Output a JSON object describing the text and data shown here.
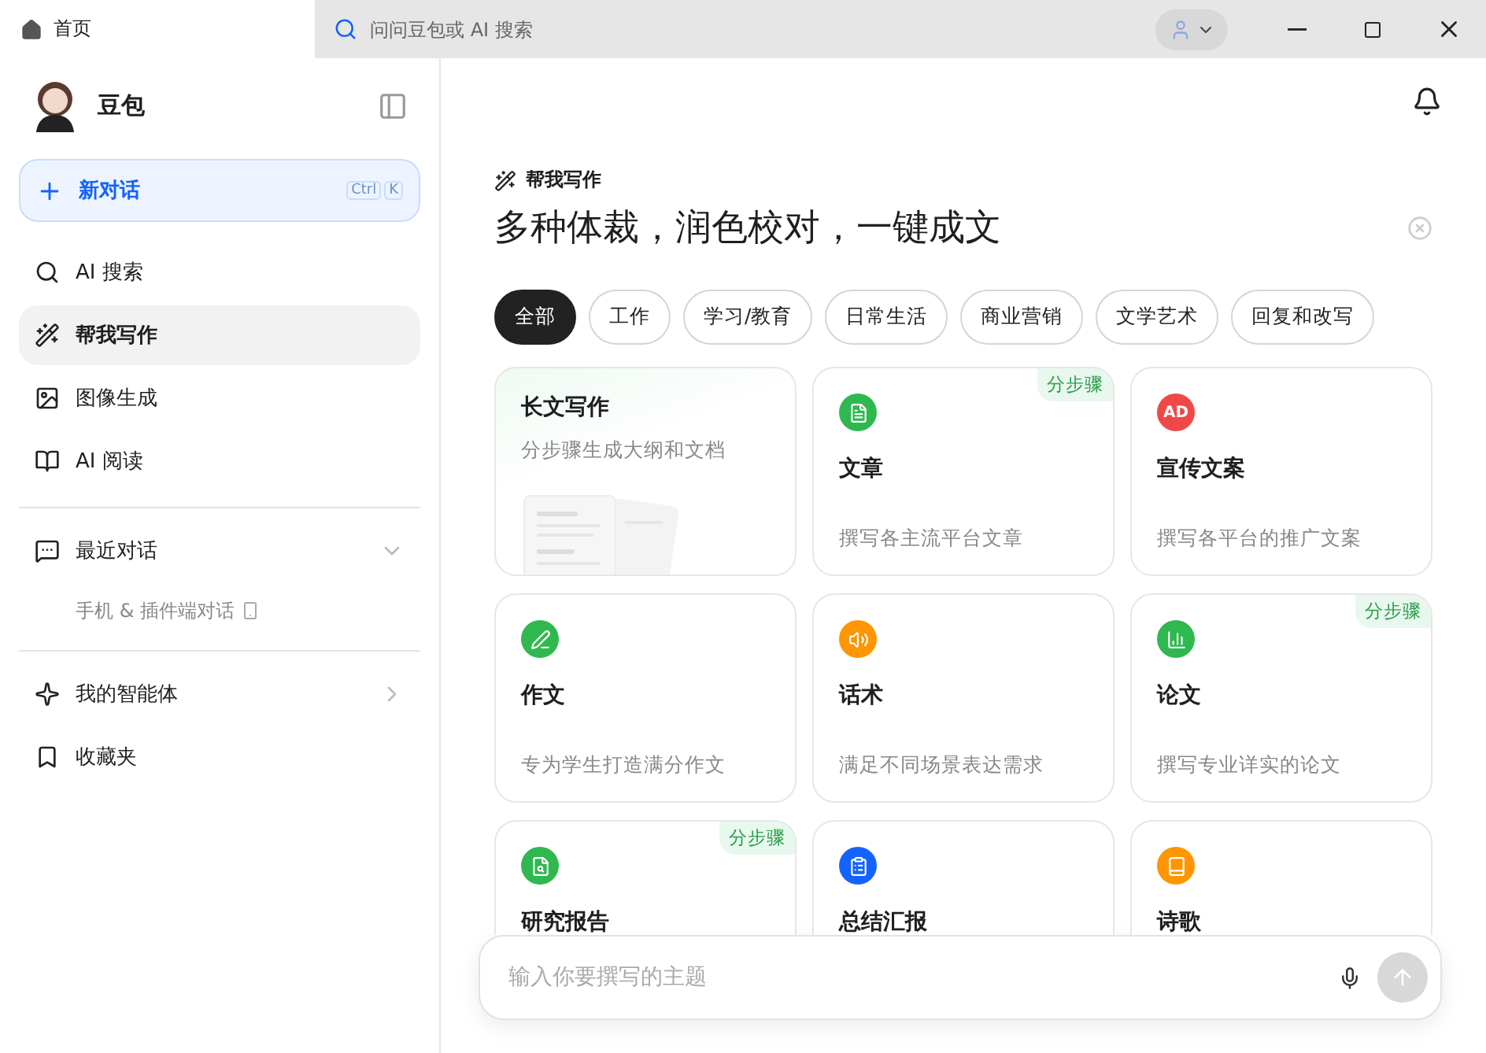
{
  "tabs": [
    {
      "label": "首页",
      "selected": true
    }
  ],
  "address_bar": {
    "placeholder": "问问豆包或 AI 搜索"
  },
  "sidebar": {
    "brand": "豆包",
    "new_chat": {
      "label": "新对话",
      "shortcut": [
        "Ctrl",
        "K"
      ]
    },
    "items": [
      {
        "label": "AI 搜索",
        "selected": false
      },
      {
        "label": "帮我写作",
        "selected": true
      },
      {
        "label": "图像生成",
        "selected": false
      },
      {
        "label": "AI 阅读",
        "selected": false
      }
    ],
    "recent": {
      "label": "最近对话",
      "expanded": true,
      "children": [
        {
          "label": "手机 & 插件端对话"
        }
      ]
    },
    "more": [
      {
        "label": "我的智能体",
        "kind": "arrow"
      },
      {
        "label": "收藏夹",
        "kind": "plain"
      }
    ]
  },
  "main": {
    "section": "帮我写作",
    "headline": "多种体裁，润色校对，一键成文",
    "filters": [
      {
        "label": "全部",
        "selected": true
      },
      {
        "label": "工作",
        "selected": false
      },
      {
        "label": "学习/教育",
        "selected": false
      },
      {
        "label": "日常生活",
        "selected": false
      },
      {
        "label": "商业营销",
        "selected": false
      },
      {
        "label": "文学艺术",
        "selected": false
      },
      {
        "label": "回复和改写",
        "selected": false
      }
    ],
    "cards": [
      {
        "kind": "long",
        "title": "长文写作",
        "description": "分步骤生成大纲和文档"
      },
      {
        "kind": "icon",
        "title": "文章",
        "description": "撰写各主流平台文章",
        "color": "#2fb84f",
        "badge": "分步骤"
      },
      {
        "kind": "icon",
        "title": "宣传文案",
        "description": "撰写各平台的推广文案",
        "color": "#f04848",
        "icon_text": "AD"
      },
      {
        "kind": "icon",
        "title": "作文",
        "description": "专为学生打造满分作文",
        "color": "#2fb84f"
      },
      {
        "kind": "icon",
        "title": "话术",
        "description": "满足不同场景表达需求",
        "color": "#ff9500"
      },
      {
        "kind": "icon",
        "title": "论文",
        "description": "撰写专业详实的论文",
        "color": "#2fb84f",
        "badge": "分步骤"
      },
      {
        "kind": "icon",
        "title": "研究报告",
        "color": "#2fb84f",
        "badge": "分步骤"
      },
      {
        "kind": "icon",
        "title": "总结汇报",
        "color": "#1463ff"
      },
      {
        "kind": "icon",
        "title": "诗歌",
        "color": "#ff9500"
      }
    ],
    "composer": {
      "placeholder": "输入你要撰写的主题"
    }
  }
}
